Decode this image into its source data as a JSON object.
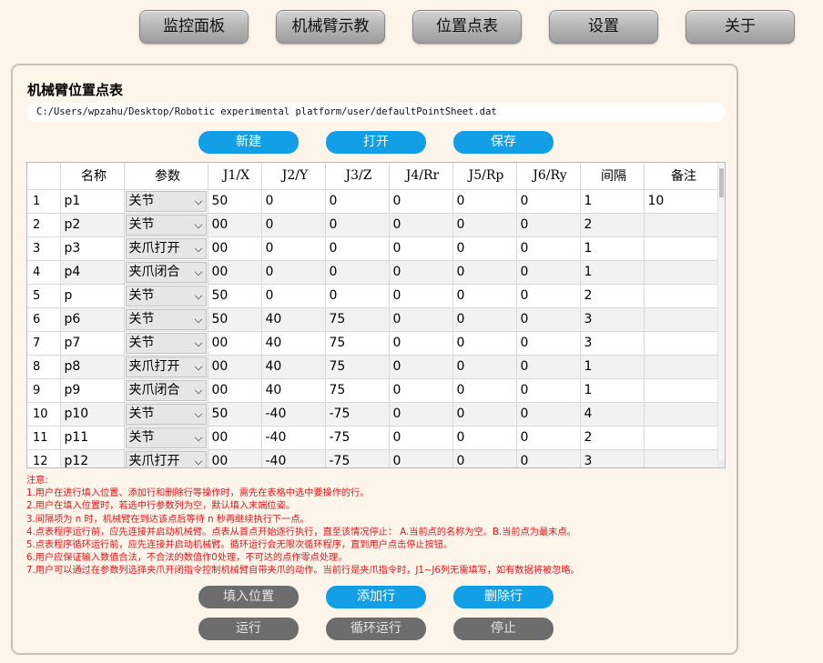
{
  "nav": {
    "tabs": [
      "监控面板",
      "机械臂示教",
      "位置点表",
      "设置",
      "关于"
    ]
  },
  "panel": {
    "title": "机械臂位置点表",
    "file_path": "C:/Users/wpzahu/Desktop/Robotic experimental platform/user/defaultPointSheet.dat",
    "buttons": {
      "new": "新建",
      "open": "打开",
      "save": "保存"
    }
  },
  "table": {
    "headers": [
      "名称",
      "参数",
      "J1/X",
      "J2/Y",
      "J3/Z",
      "J4/Rr",
      "J5/Rp",
      "J6/Ry",
      "间隔",
      "备注"
    ],
    "rows": [
      {
        "num": "1",
        "name": "p1",
        "param": "关节",
        "j1": "50",
        "j2": "0",
        "j3": "0",
        "j4": "0",
        "j5": "0",
        "j6": "0",
        "interval": "1",
        "note": "10"
      },
      {
        "num": "2",
        "name": "p2",
        "param": "关节",
        "j1": "00",
        "j2": "0",
        "j3": "0",
        "j4": "0",
        "j5": "0",
        "j6": "0",
        "interval": "2",
        "note": ""
      },
      {
        "num": "3",
        "name": "p3",
        "param": "夹爪打开",
        "j1": "00",
        "j2": "0",
        "j3": "0",
        "j4": "0",
        "j5": "0",
        "j6": "0",
        "interval": "1",
        "note": ""
      },
      {
        "num": "4",
        "name": "p4",
        "param": "夹爪闭合",
        "j1": "00",
        "j2": "0",
        "j3": "0",
        "j4": "0",
        "j5": "0",
        "j6": "0",
        "interval": "1",
        "note": ""
      },
      {
        "num": "5",
        "name": "p",
        "param": "关节",
        "j1": "50",
        "j2": "0",
        "j3": "0",
        "j4": "0",
        "j5": "0",
        "j6": "0",
        "interval": "2",
        "note": ""
      },
      {
        "num": "6",
        "name": "p6",
        "param": "关节",
        "j1": "50",
        "j2": "40",
        "j3": "75",
        "j4": "0",
        "j5": "0",
        "j6": "0",
        "interval": "3",
        "note": ""
      },
      {
        "num": "7",
        "name": "p7",
        "param": "关节",
        "j1": "00",
        "j2": "40",
        "j3": "75",
        "j4": "0",
        "j5": "0",
        "j6": "0",
        "interval": "3",
        "note": ""
      },
      {
        "num": "8",
        "name": "p8",
        "param": "夹爪打开",
        "j1": "00",
        "j2": "40",
        "j3": "75",
        "j4": "0",
        "j5": "0",
        "j6": "0",
        "interval": "1",
        "note": ""
      },
      {
        "num": "9",
        "name": "p9",
        "param": "夹爪闭合",
        "j1": "00",
        "j2": "40",
        "j3": "75",
        "j4": "0",
        "j5": "0",
        "j6": "0",
        "interval": "1",
        "note": ""
      },
      {
        "num": "10",
        "name": "p10",
        "param": "关节",
        "j1": "50",
        "j2": "-40",
        "j3": "-75",
        "j4": "0",
        "j5": "0",
        "j6": "0",
        "interval": "4",
        "note": ""
      },
      {
        "num": "11",
        "name": "p11",
        "param": "关节",
        "j1": "00",
        "j2": "-40",
        "j3": "-75",
        "j4": "0",
        "j5": "0",
        "j6": "0",
        "interval": "2",
        "note": ""
      },
      {
        "num": "12",
        "name": "p12",
        "param": "夹爪打开",
        "j1": "00",
        "j2": "-40",
        "j3": "-75",
        "j4": "0",
        "j5": "0",
        "j6": "0",
        "interval": "3",
        "note": ""
      }
    ]
  },
  "notes": [
    "注意:",
    "1.用户在进行填入位置、添加行和删除行等操作时，需先在表格中选中要操作的行。",
    "2.用户在填入位置时，若选中行参数列为空，默认填入末端位姿。",
    "3.间隔项为 n 时，机械臂在到达该点后等待 n 秒再继续执行下一点。",
    "4.点表程序运行前，应先连接并启动机械臂。点表从首点开始逐行执行，直至该情况停止： A.当前点的名称为空。B.当前点为最末点。",
    "5.点表程序循环运行前，应先连接并启动机械臂。循环运行会无限次循环程序，直到用户点击停止按钮。",
    "6.用户应保证输入数值合法，不合法的数值作0处理，不可达的点作零点处理。",
    "7.用户可以通过在参数列选择夹爪开闭指令控制机械臂自带夹爪的动作。当前行是夹爪指令时，J1~J6列无需填写，如有数据将被忽略。"
  ],
  "actions": {
    "fill_position": "填入位置",
    "add_row": "添加行",
    "delete_row": "删除行",
    "run": "运行",
    "loop_run": "循环运行",
    "stop": "停止"
  },
  "colors": {
    "accent": "#129fe6",
    "disabled": "#6d6d6d",
    "warning": "#e0151b",
    "background": "#fdf5ea"
  }
}
